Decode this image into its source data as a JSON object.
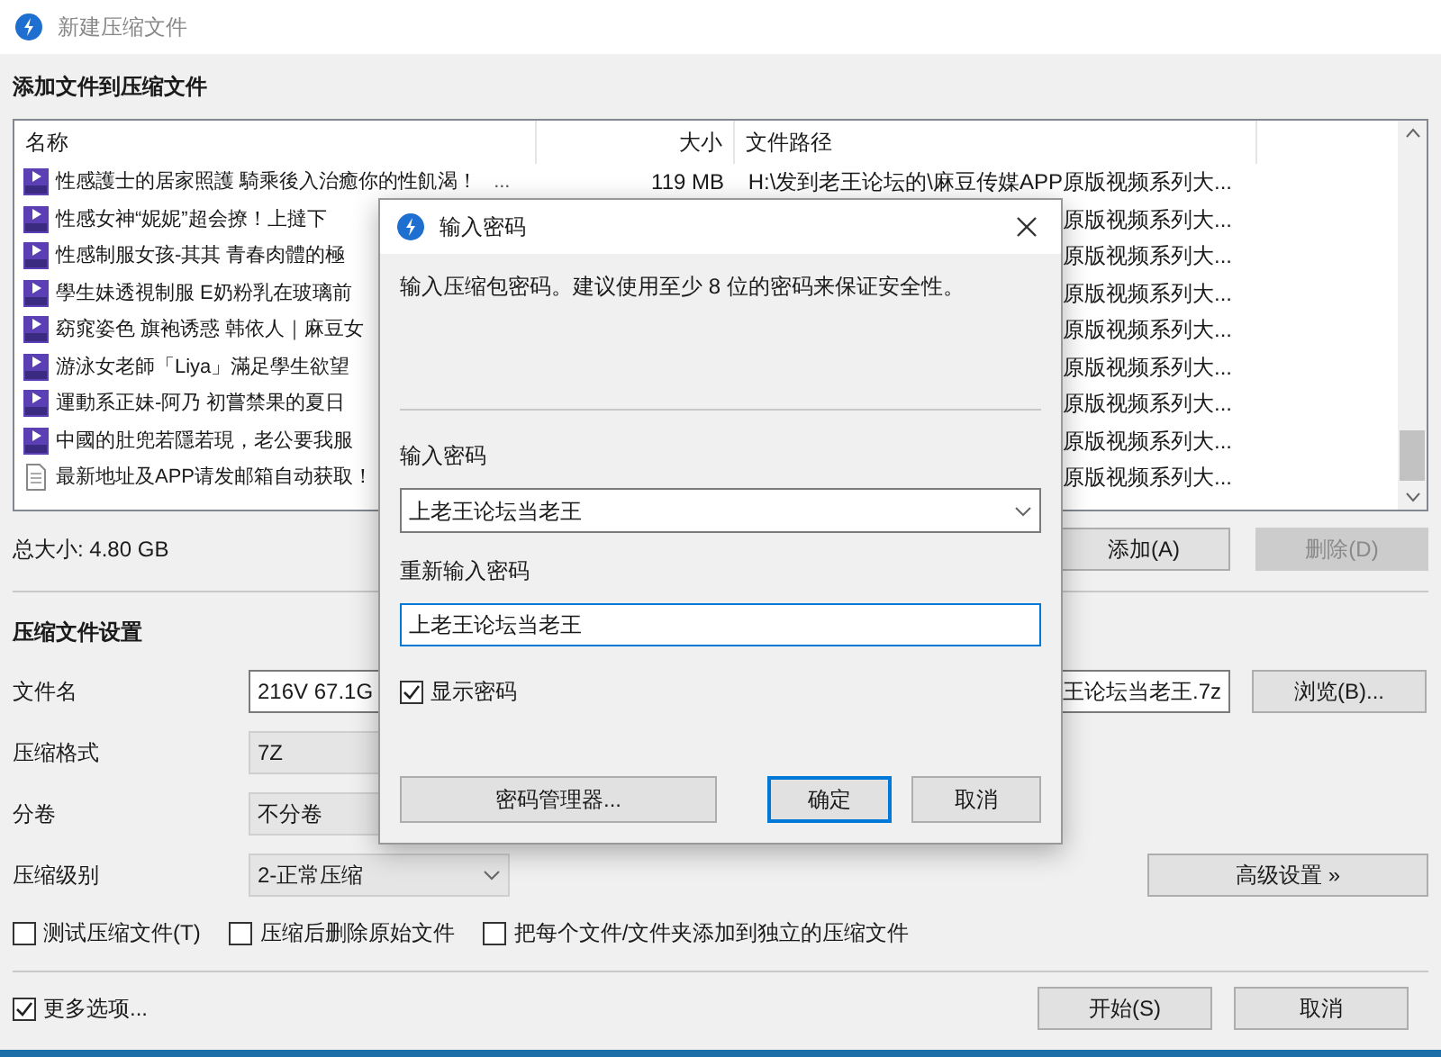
{
  "window": {
    "title": "新建压缩文件"
  },
  "files_section": {
    "heading": "添加文件到压缩文件",
    "columns": [
      "名称",
      "大小",
      "文件路径"
    ],
    "rows": [
      {
        "kind": "video",
        "name": "性感護士的居家照護 騎乘後入治癒你的性飢渴！",
        "name_more": "...",
        "size": "119 MB",
        "path": "H:\\发到老王论坛的\\麻豆传媒APP原版视频系列大..."
      },
      {
        "kind": "video",
        "name": "性感女神“妮妮”超会撩！上撻下",
        "path": "原版视频系列大..."
      },
      {
        "kind": "video",
        "name": "性感制服女孩-其其 青春肉體的極",
        "path": "原版视频系列大..."
      },
      {
        "kind": "video",
        "name": "學生妹透視制服 E奶粉乳在玻璃前",
        "path": "原版视频系列大..."
      },
      {
        "kind": "video",
        "name": "窈窕姿色 旗袍诱惑 韩依人｜麻豆女",
        "path": "原版视频系列大..."
      },
      {
        "kind": "video",
        "name": "游泳女老師「Liya」滿足學生欲望",
        "path": "原版视频系列大..."
      },
      {
        "kind": "video",
        "name": "運動系正妹-阿乃 初嘗禁果的夏日",
        "path": "原版视频系列大..."
      },
      {
        "kind": "video",
        "name": "中國的肚兜若隱若現，老公要我服",
        "path": "原版视频系列大..."
      },
      {
        "kind": "text",
        "name": "最新地址及APP请发邮箱自动获取！",
        "path": "原版视频系列大..."
      }
    ],
    "total": "总大小: 4.80 GB",
    "buttons": [
      {
        "label": "添加(A)",
        "disabled": false
      },
      {
        "label": "删除(D)",
        "disabled": true
      }
    ]
  },
  "settings": {
    "heading": "压缩文件设置",
    "filename": {
      "label": "文件名",
      "value_start": "216V 67.1G",
      "value_end": "王论坛当老王.7z",
      "button": "浏览(B)..."
    },
    "format": {
      "label": "压缩格式",
      "value": "7Z"
    },
    "split": {
      "label": "分卷",
      "value": "不分卷"
    },
    "level": {
      "label": "压缩级别",
      "value": "2-正常压缩"
    },
    "advanced_button": "高级设置 »",
    "options": [
      {
        "label": "测试压缩文件(T)",
        "checked": false
      },
      {
        "label": "压缩后删除原始文件",
        "checked": false
      },
      {
        "label": "把每个文件/文件夹添加到独立的压缩文件",
        "checked": false
      }
    ]
  },
  "footer": {
    "more_options": {
      "label": "更多选项...",
      "checked": true
    },
    "buttons": [
      {
        "label": "开始(S)"
      },
      {
        "label": "取消"
      }
    ]
  },
  "dialog": {
    "title": "输入密码",
    "message": "输入压缩包密码。建议使用至少 8 位的密码来保证安全性。",
    "password": {
      "label": "输入密码",
      "value": "上老王论坛当老王"
    },
    "confirm": {
      "label": "重新输入密码",
      "value": "上老王论坛当老王"
    },
    "show_password": {
      "label": "显示密码",
      "checked": true
    },
    "buttons": [
      {
        "label": "密码管理器...",
        "default": false
      },
      {
        "label": "确定",
        "default": true
      },
      {
        "label": "取消",
        "default": false
      }
    ]
  }
}
